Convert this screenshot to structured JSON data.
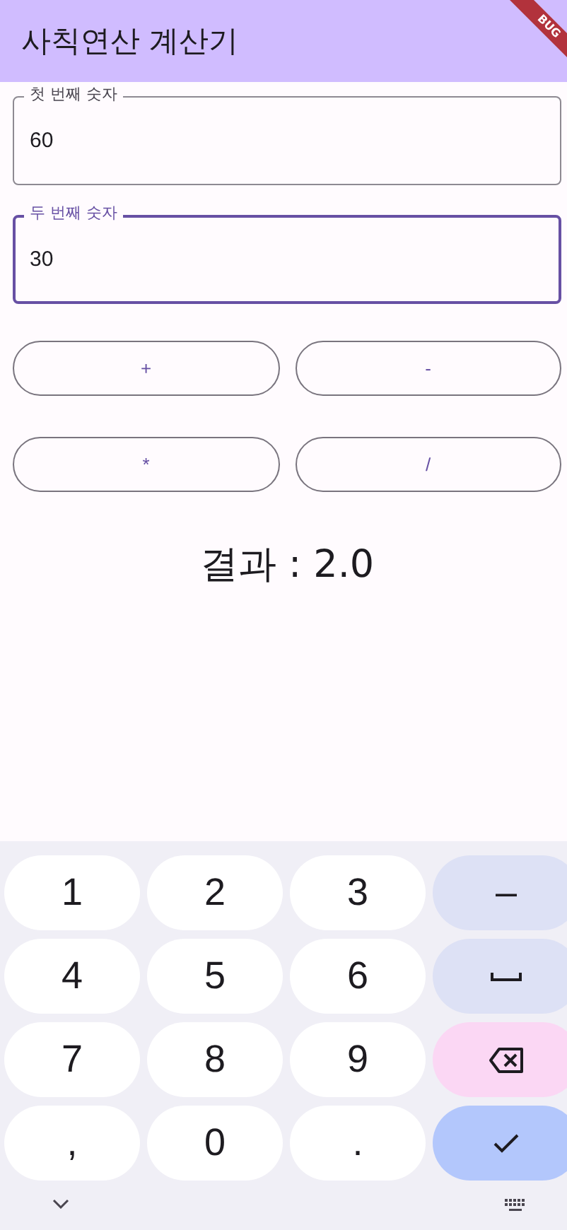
{
  "app_bar": {
    "title": "사칙연산 계산기",
    "debug_banner": "BUG"
  },
  "fields": [
    {
      "label": "첫 번째 숫자",
      "value": "60",
      "focused": false
    },
    {
      "label": "두 번째 숫자",
      "value": "30",
      "focused": true
    }
  ],
  "operator_buttons": [
    "+",
    "-",
    "*",
    "/"
  ],
  "result": "결과 : 2.0",
  "keyboard": {
    "keys": [
      {
        "kind": "text",
        "label": "1"
      },
      {
        "kind": "text",
        "label": "2"
      },
      {
        "kind": "text",
        "label": "3"
      },
      {
        "kind": "symbol",
        "label": "–"
      },
      {
        "kind": "text",
        "label": "4"
      },
      {
        "kind": "text",
        "label": "5"
      },
      {
        "kind": "text",
        "label": "6"
      },
      {
        "kind": "space"
      },
      {
        "kind": "text",
        "label": "7"
      },
      {
        "kind": "text",
        "label": "8"
      },
      {
        "kind": "text",
        "label": "9"
      },
      {
        "kind": "backspace"
      },
      {
        "kind": "text",
        "label": ","
      },
      {
        "kind": "text",
        "label": "0"
      },
      {
        "kind": "text",
        "label": "."
      },
      {
        "kind": "done"
      }
    ]
  }
}
